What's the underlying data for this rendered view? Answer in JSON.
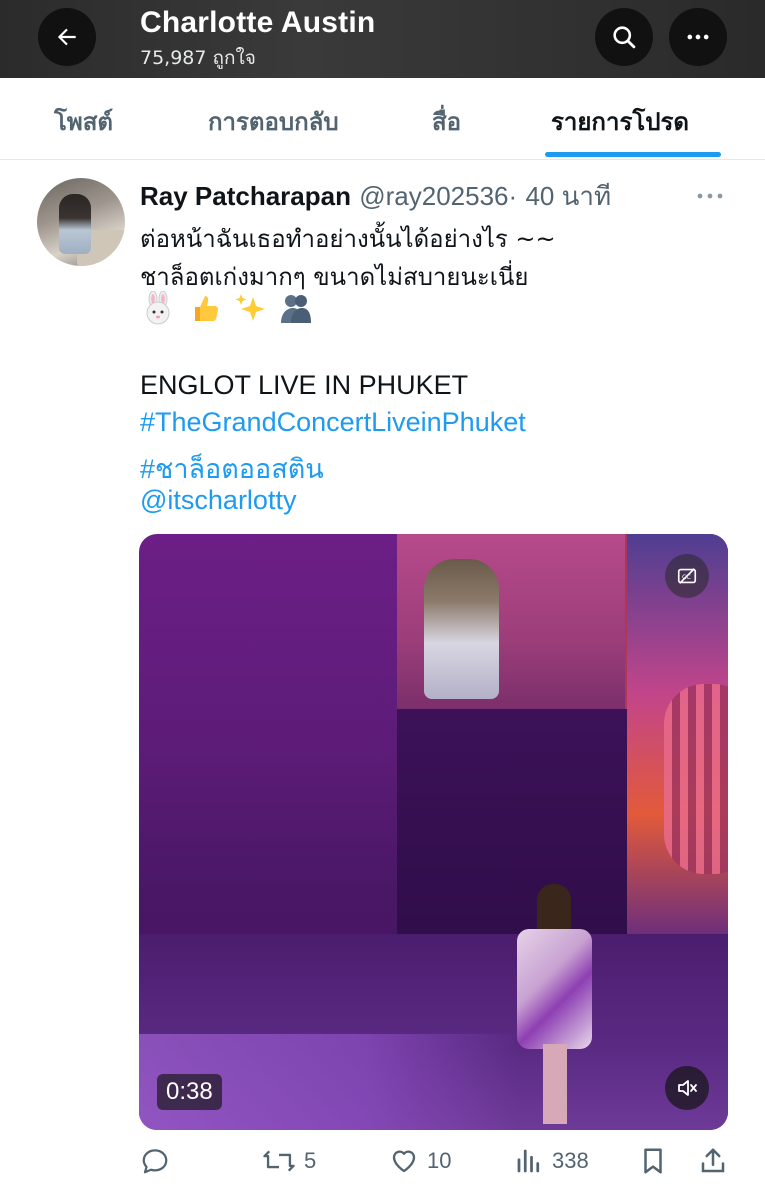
{
  "header": {
    "title": "Charlotte Austin",
    "subtitle": "75,987 ถูกใจ",
    "icons": {
      "back": "arrow-left-icon",
      "search": "search-icon",
      "more": "more-horizontal-icon"
    }
  },
  "tabs": [
    {
      "label": "โพสต์",
      "active": false
    },
    {
      "label": "การตอบกลับ",
      "active": false
    },
    {
      "label": "สื่อ",
      "active": false
    },
    {
      "label": "รายการโปรด",
      "active": true
    }
  ],
  "tweet": {
    "author_name": "Ray Patcharapan",
    "handle": "@ray202536",
    "separator": "·",
    "time": "40 นาที",
    "lines": [
      "ต่อหน้าฉันเธอทำอย่างนั้นได้อย่างไร ~~",
      "ชาล็อตเก่งมากๆ ขนาดไม่สบายนะเนี่ย"
    ],
    "emojis": [
      "rabbit-face-emoji",
      "thumbs-up-emoji",
      "sparkles-emoji",
      "two-people-hugging-emoji"
    ],
    "body_title": "ENGLOT LIVE IN PHUKET",
    "hashtag1": "#TheGrandConcertLiveinPhuket",
    "hashtag2": "#ชาล็อตออสติน",
    "mention": "@itscharlotty",
    "video_duration": "0:38"
  },
  "actions": {
    "replies": "",
    "reposts": "5",
    "likes": "10",
    "views": "338"
  },
  "colors": {
    "accent": "#1d9bf0",
    "text": "#0f1419",
    "muted": "#536471",
    "header_bg": "#2f2f2f"
  }
}
